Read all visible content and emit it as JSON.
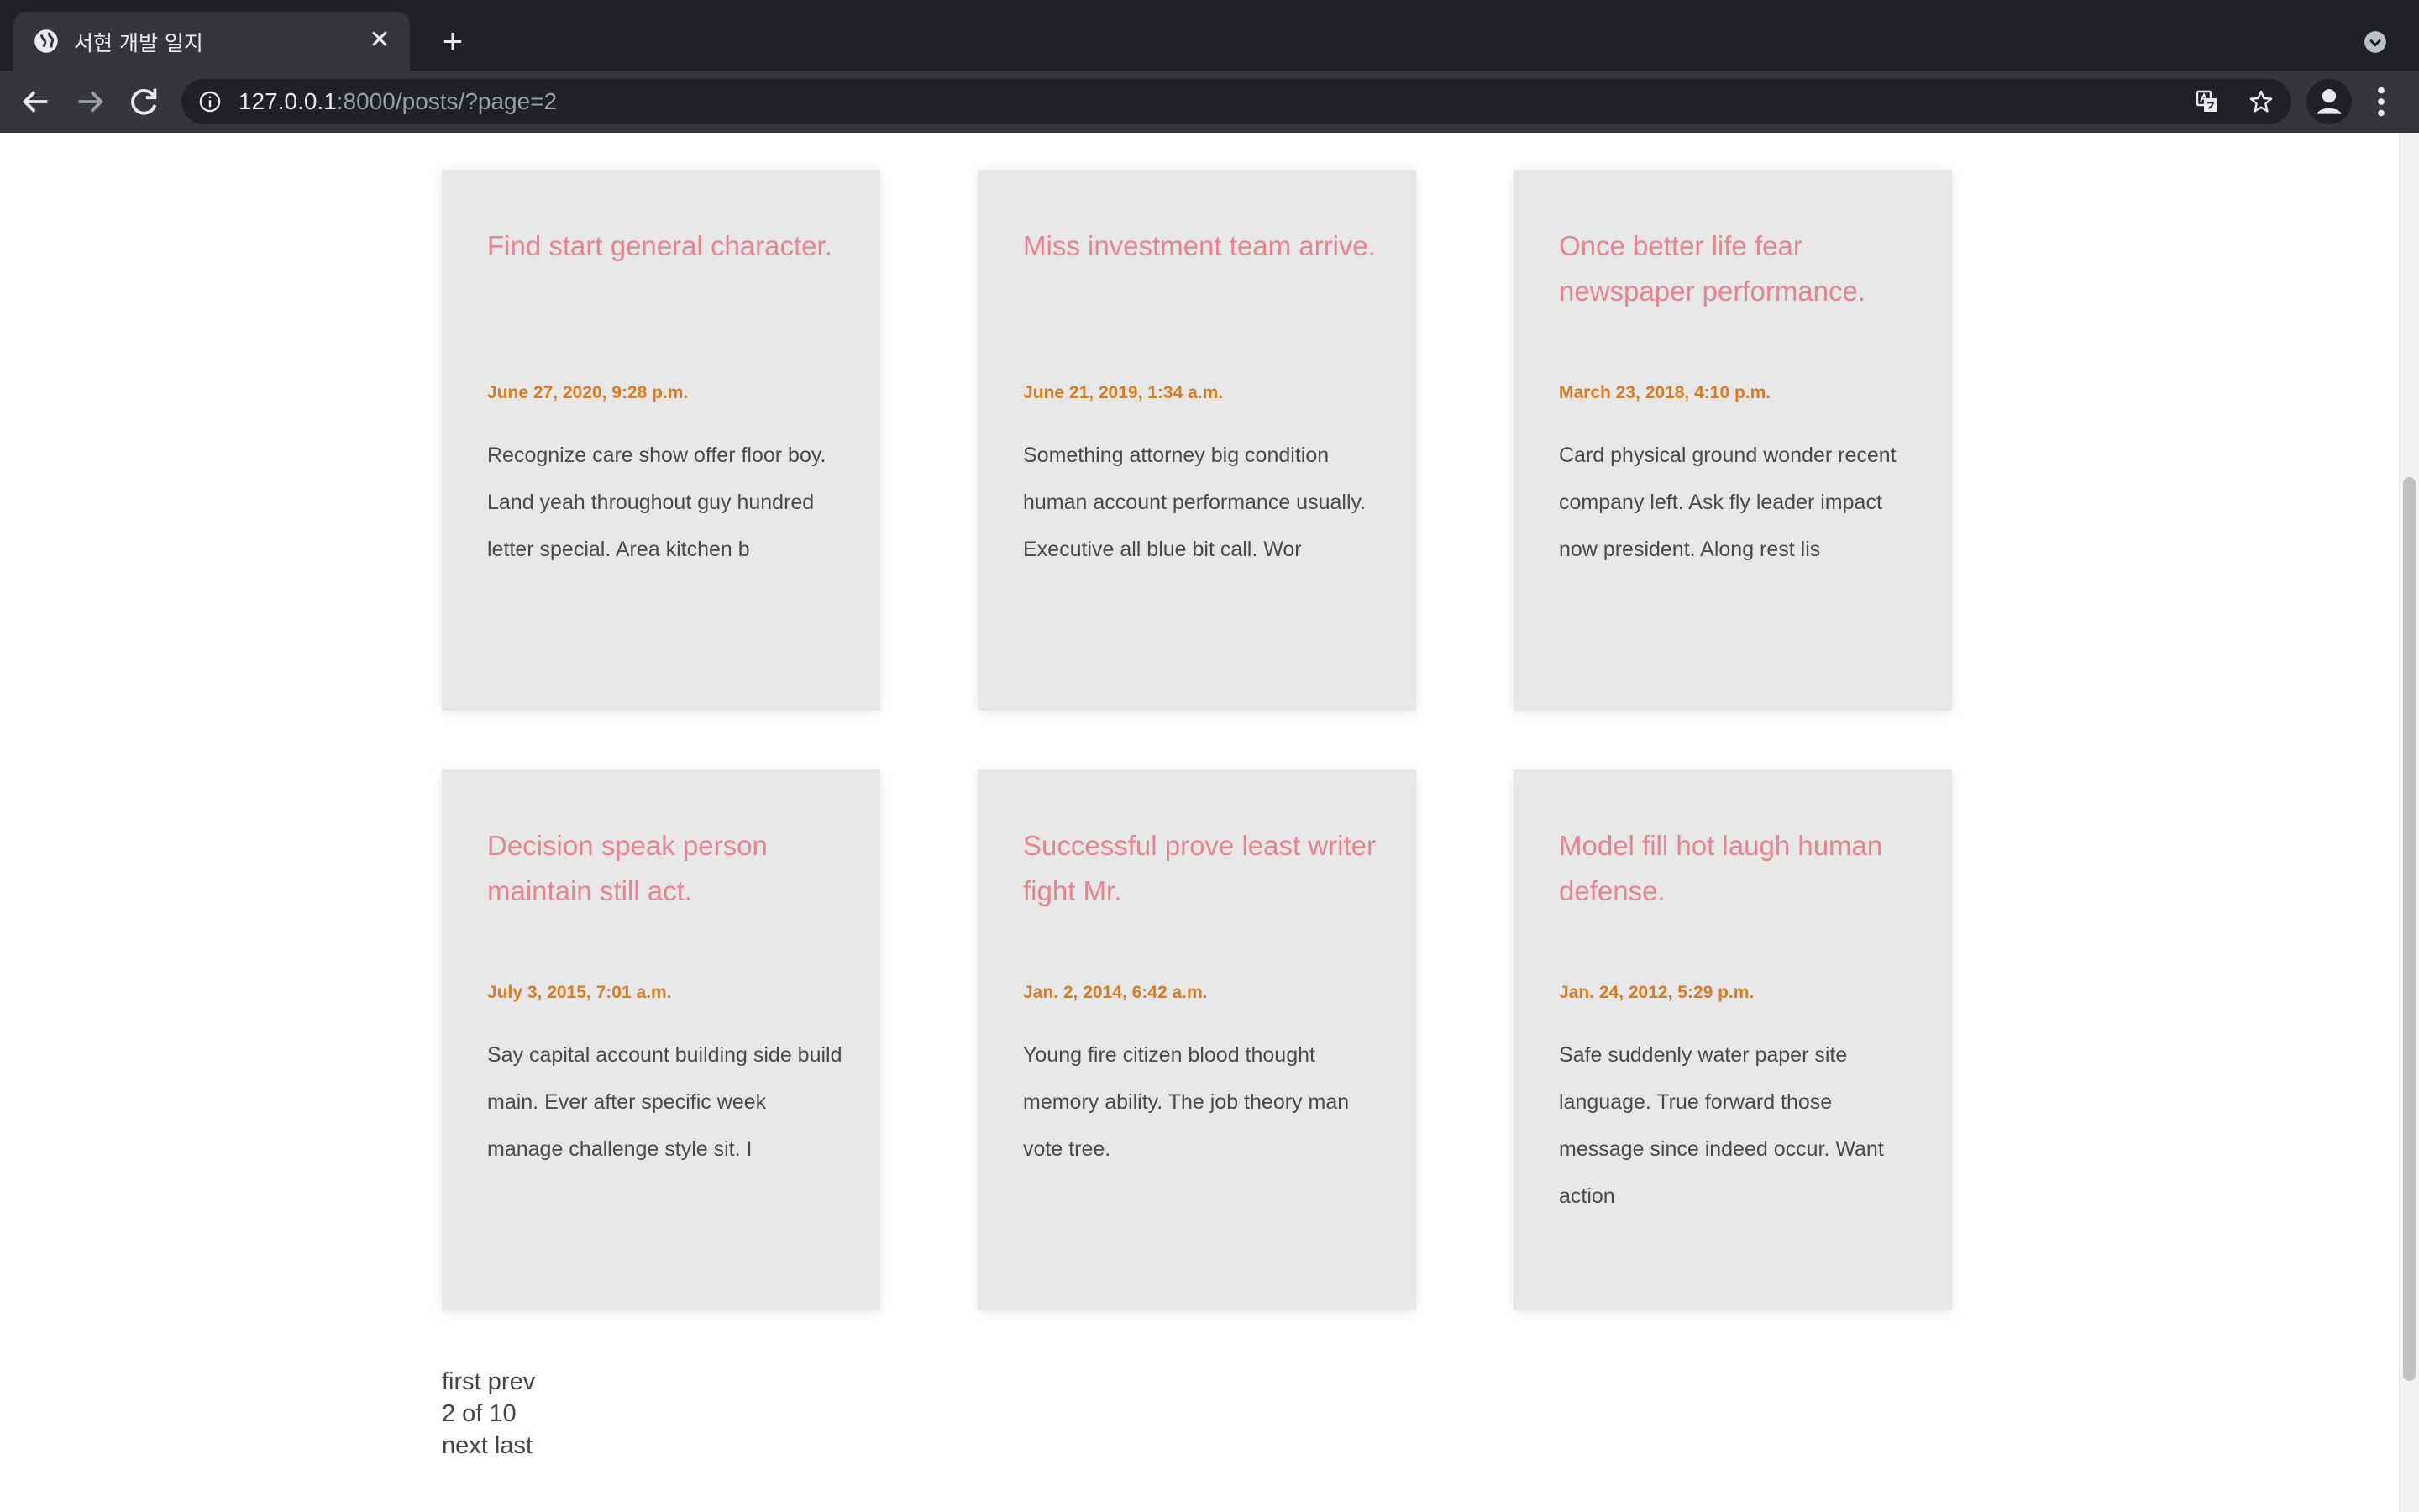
{
  "browser": {
    "tab_title": "서현 개발 일지",
    "url_host": "127.0.0.1",
    "url_path": ":8000/posts/?page=2"
  },
  "posts": [
    {
      "title": "Find start general character.",
      "date": "June 27, 2020, 9:28 p.m.",
      "excerpt": "Recognize care show offer floor boy. Land yeah throughout guy hundred letter special. Area kitchen b"
    },
    {
      "title": "Miss investment team arrive.",
      "date": "June 21, 2019, 1:34 a.m.",
      "excerpt": "Something attorney big condition human account performance usually. Executive all blue bit call. Wor"
    },
    {
      "title": "Once better life fear newspaper performance.",
      "date": "March 23, 2018, 4:10 p.m.",
      "excerpt": "Card physical ground wonder recent company left. Ask fly leader impact now president. Along rest lis"
    },
    {
      "title": "Decision speak person maintain still act.",
      "date": "July 3, 2015, 7:01 a.m.",
      "excerpt": "Say capital account building side build main. Ever after specific week manage challenge style sit. I"
    },
    {
      "title": "Successful prove least writer fight Mr.",
      "date": "Jan. 2, 2014, 6:42 a.m.",
      "excerpt": "Young fire citizen blood thought memory ability. The job theory man vote tree."
    },
    {
      "title": "Model fill hot laugh human defense.",
      "date": "Jan. 24, 2012, 5:29 p.m.",
      "excerpt": "Safe suddenly water paper site language. True forward those message since indeed occur. Want action"
    }
  ],
  "pagination": {
    "first": "first",
    "prev": "prev",
    "current": "2 of 10",
    "next": "next",
    "last": "last"
  }
}
